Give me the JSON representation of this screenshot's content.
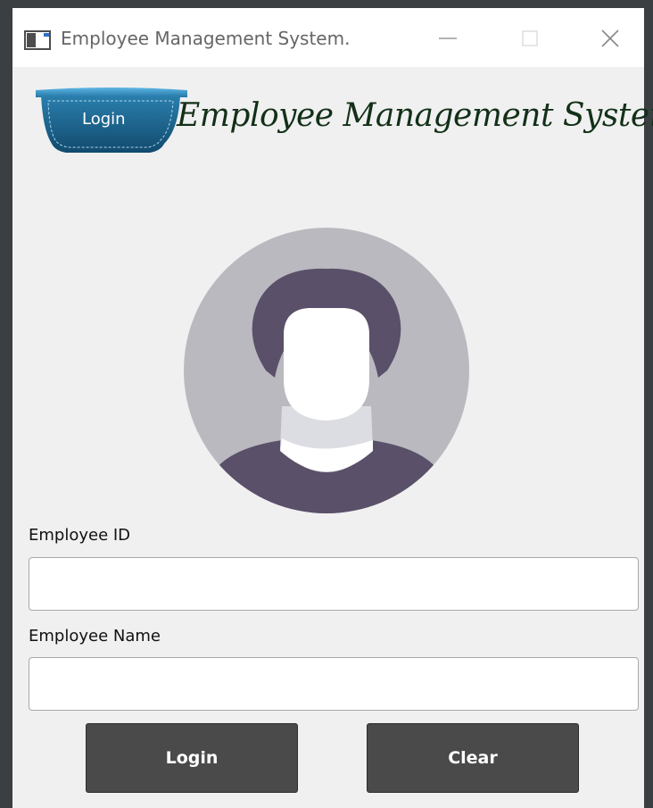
{
  "window": {
    "title": "Employee Management System."
  },
  "header": {
    "ribbon_label": "Login",
    "app_title": "Employee Management System"
  },
  "form": {
    "employee_id": {
      "label": "Employee ID",
      "value": "",
      "placeholder": ""
    },
    "employee_name": {
      "label": "Employee Name",
      "value": "",
      "placeholder": ""
    }
  },
  "buttons": {
    "login_label": "Login",
    "clear_label": "Clear"
  },
  "icons": {
    "app": "app-window-icon",
    "minimize": "minimize-icon",
    "maximize": "maximize-icon",
    "close": "close-icon",
    "avatar": "user-avatar-icon",
    "ribbon": "ribbon-badge-icon"
  },
  "colors": {
    "titlebar": "#ffffff",
    "window_background": "#f0f0f0",
    "ribbon_blue": "#1e5f85",
    "heading_green": "#123018",
    "avatar_circle": "#b9b9bf",
    "avatar_dark": "#5a5069",
    "button_background": "#4a4a4a"
  }
}
